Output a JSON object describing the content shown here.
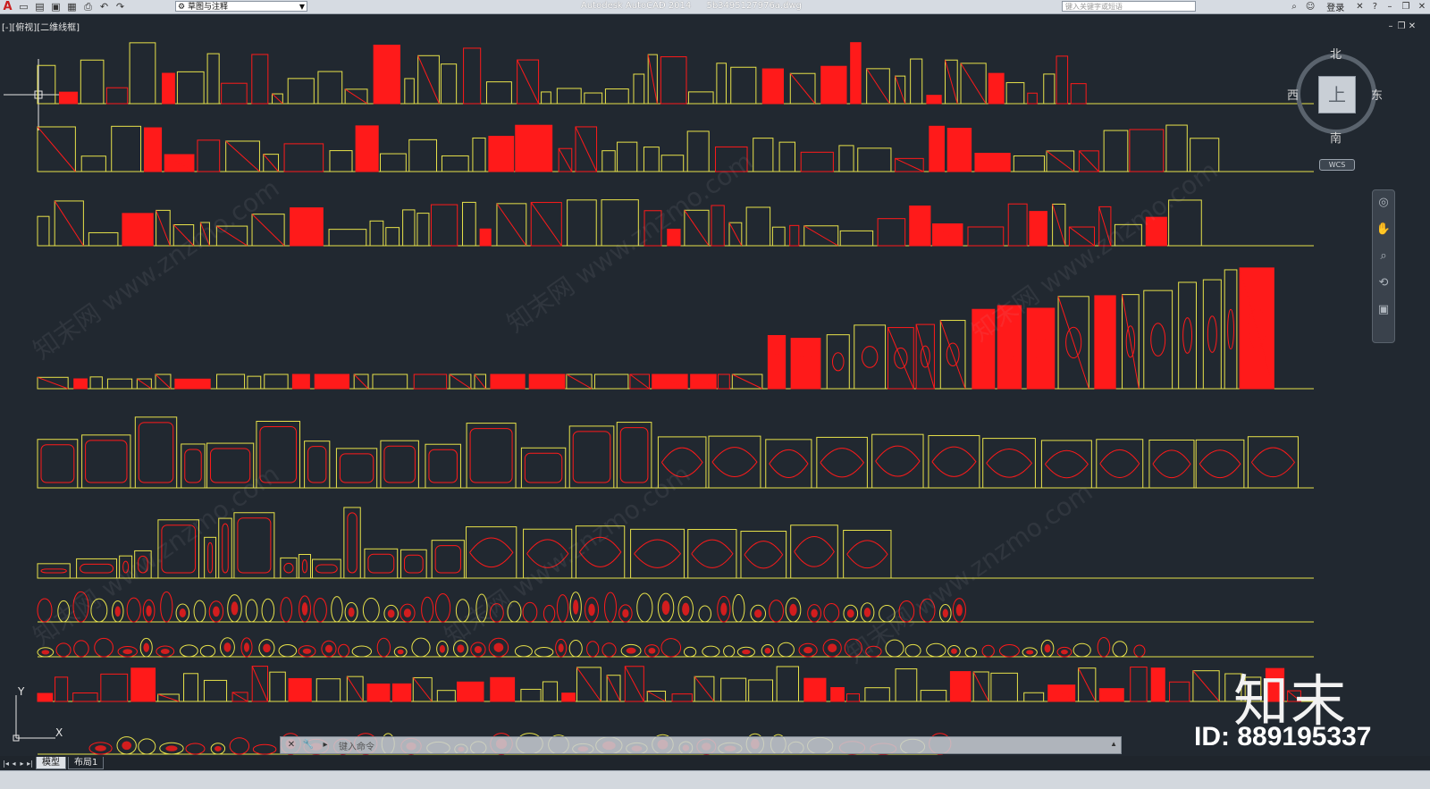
{
  "titlebar": {
    "app_icon": "autocad-logo-icon",
    "quick_access_icons": [
      "new-icon",
      "open-icon",
      "save-icon",
      "saveas-icon",
      "print-icon",
      "undo-icon",
      "redo-icon"
    ],
    "workspace": "草图与注释",
    "app_name": "Autodesk AutoCAD 2014",
    "filename": "5b3495127976a.dwg",
    "search_placeholder": "键入关键字或短语",
    "login_label": "登录",
    "window_buttons": [
      "minimize-icon",
      "restore-icon",
      "close-icon"
    ]
  },
  "viewport": {
    "label": "[-][俯视][二维线框]"
  },
  "viewcube": {
    "north": "北",
    "south": "南",
    "west": "西",
    "east": "东",
    "face": "上",
    "ucs_label": "WCS"
  },
  "ucs_icon": {
    "x_label": "X",
    "y_label": "Y"
  },
  "command_line": {
    "prompt": "键入命令"
  },
  "layout_tabs": [
    "模型",
    "布局1"
  ],
  "watermarks": {
    "logo_text": "知末",
    "id_text": "ID: 889195337",
    "site_text": "知末网 www.znzmo.com"
  },
  "colors": {
    "background": "#212830",
    "yellow": "#e8e24a",
    "red": "#ff1a1a"
  }
}
